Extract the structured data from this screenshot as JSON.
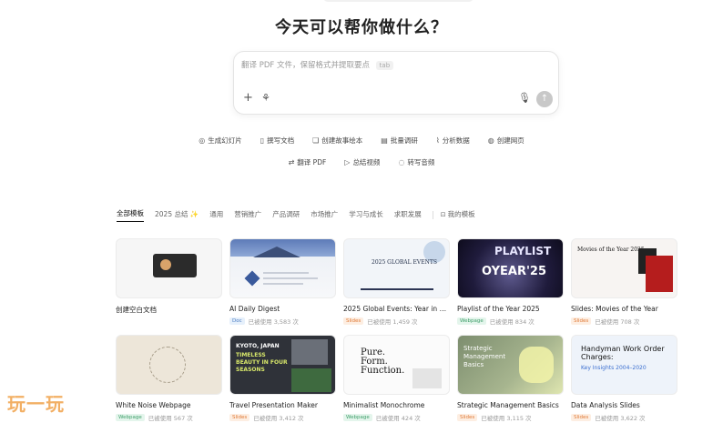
{
  "headline": "今天可以帮你做什么？",
  "prompt": {
    "placeholder": "翻译 PDF 文件，保留格式并提取要点",
    "tab_hint": "tab",
    "icons": [
      "plus-icon",
      "tools-icon",
      "mic-icon",
      "send-icon"
    ]
  },
  "quick_actions": {
    "row1": [
      {
        "label": "生成幻灯片",
        "icon": "slides-icon"
      },
      {
        "label": "撰写文档",
        "icon": "doc-icon"
      },
      {
        "label": "创建故事绘本",
        "icon": "book-icon"
      },
      {
        "label": "批量调研",
        "icon": "research-icon"
      },
      {
        "label": "分析数据",
        "icon": "chart-icon"
      },
      {
        "label": "创建网页",
        "icon": "web-icon"
      }
    ],
    "row2": [
      {
        "label": "翻译 PDF",
        "icon": "translate-icon"
      },
      {
        "label": "总结视频",
        "icon": "video-icon"
      },
      {
        "label": "转写音频",
        "icon": "audio-icon"
      }
    ]
  },
  "tabs": [
    {
      "label": "全部模板",
      "active": true
    },
    {
      "label": "2025 总结 ✨",
      "active": false
    },
    {
      "label": "通用",
      "active": false
    },
    {
      "label": "营销推广",
      "active": false
    },
    {
      "label": "产品调研",
      "active": false
    },
    {
      "label": "市场推广",
      "active": false
    },
    {
      "label": "学习与成长",
      "active": false
    },
    {
      "label": "求职发展",
      "active": false
    }
  ],
  "my_templates": "我的模板",
  "templates": [
    {
      "title": "创建空白文档",
      "badge": "",
      "usage": ""
    },
    {
      "title": "AI Daily Digest",
      "badge": "Doc",
      "badge_color": "blue",
      "usage": "已被使用 3,583 次"
    },
    {
      "title": "2025 Global Events: Year in Revi…",
      "badge": "Slides",
      "badge_color": "orange",
      "usage": "已被使用 1,459 次"
    },
    {
      "title": "Playlist of the Year 2025",
      "badge": "Webpage",
      "badge_color": "green",
      "usage": "已被使用 834 次"
    },
    {
      "title": "Slides: Movies of the Year",
      "badge": "Slides",
      "badge_color": "orange",
      "usage": "已被使用 708 次"
    },
    {
      "title": "White Noise Webpage",
      "badge": "Webpage",
      "badge_color": "green",
      "usage": "已被使用 567 次"
    },
    {
      "title": "Travel Presentation Maker",
      "badge": "Slides",
      "badge_color": "orange",
      "usage": "已被使用 3,412 次"
    },
    {
      "title": "Minimalist Monochrome",
      "badge": "Webpage",
      "badge_color": "green",
      "usage": "已被使用 424 次"
    },
    {
      "title": "Strategic Management Basics",
      "badge": "Slides",
      "badge_color": "orange",
      "usage": "已被使用 3,115 次"
    },
    {
      "title": "Data Analysis Slides",
      "badge": "Slides",
      "badge_color": "orange",
      "usage": "已被使用 3,622 次"
    }
  ],
  "thumb_text": {
    "events": "2025 GLOBAL EVENTS",
    "playlist_1": "PLAYLIST",
    "playlist_2": "OYEAR'25",
    "movies": "Movies of the Year 2025",
    "travel_1": "KYOTO, JAPAN",
    "travel_2": "TIMELESS BEAUTY IN FOUR SEASONS",
    "mono": "Pure. Form. Function.",
    "strategic": "Strategic Management Basics",
    "data_1": "Handyman Work Order Charges:",
    "data_2": "Key Insights 2004–2020"
  },
  "watermark": "玩一玩"
}
